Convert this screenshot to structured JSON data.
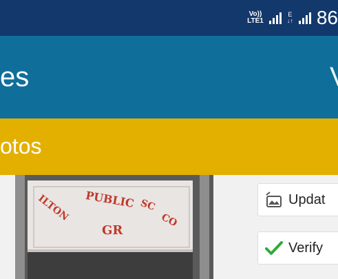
{
  "status_bar": {
    "volte_top": "Vo))",
    "volte_bottom": "LTE1",
    "network_type_top": "E",
    "network_type_bottom": "↓↑",
    "battery_text": "86"
  },
  "app_bar": {
    "title": "es",
    "action_text": "V"
  },
  "tab_bar": {
    "label": "otos"
  },
  "photo": {
    "sign_lines": [
      "ILTON",
      "PUBLIC",
      "SC",
      "CO",
      "GR"
    ]
  },
  "actions": {
    "update_label": "Updat",
    "verify_label": "Verify"
  },
  "colors": {
    "status_bar": "#13386b",
    "app_bar": "#0f6f9a",
    "tab_bar": "#e3b000",
    "verify_check": "#2eaa3a"
  }
}
